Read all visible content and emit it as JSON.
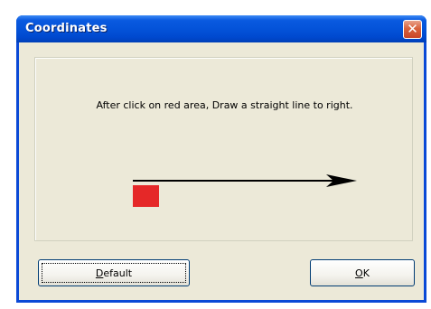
{
  "window": {
    "title": "Coordinates",
    "close_glyph": "✕"
  },
  "content": {
    "instruction": "After click on red area, Draw a straight line to right.",
    "target_color": "#e52828",
    "arrow_color": "#000000",
    "arrow_icon": "right-arrow-icon"
  },
  "buttons": {
    "default": {
      "mnemonic": "D",
      "rest": "efault"
    },
    "ok": {
      "mnemonic": "O",
      "rest": "K"
    }
  },
  "colors": {
    "titlebar": "#0453d9",
    "client": "#ece9d8",
    "close": "#d9623c"
  }
}
